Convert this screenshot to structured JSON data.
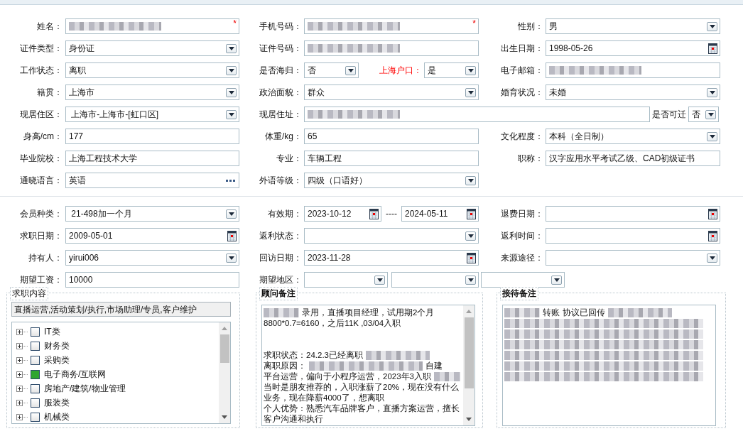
{
  "form_rows": [
    {
      "cells": [
        {
          "label": "姓名：",
          "controls": [
            {
              "kind": "text",
              "redacted": true,
              "required_mark": "*"
            }
          ]
        },
        {
          "label": "手机号码：",
          "controls": [
            {
              "kind": "text",
              "redacted": true,
              "required_mark": "*"
            }
          ]
        },
        {
          "label": "性别：",
          "controls": [
            {
              "kind": "select",
              "value": "男"
            }
          ]
        }
      ]
    },
    {
      "cells": [
        {
          "label": "证件类型：",
          "controls": [
            {
              "kind": "select",
              "value": "身份证"
            }
          ]
        },
        {
          "label": "证件号码：",
          "controls": [
            {
              "kind": "text",
              "redacted": true
            }
          ]
        },
        {
          "label": "出生日期：",
          "controls": [
            {
              "kind": "date",
              "value": "1998-05-26"
            }
          ]
        }
      ]
    },
    {
      "cells": [
        {
          "label": "工作状态：",
          "controls": [
            {
              "kind": "select",
              "value": "离职"
            }
          ]
        },
        {
          "label": "是否海归：",
          "controls": [
            {
              "kind": "select",
              "value": "否"
            },
            {
              "kind": "label",
              "text": "上海户口：",
              "highlighted": true
            },
            {
              "kind": "select",
              "value": "是"
            }
          ]
        },
        {
          "label": "电子邮箱：",
          "controls": [
            {
              "kind": "text",
              "redacted": true
            }
          ]
        }
      ]
    },
    {
      "cells": [
        {
          "label": "籍贯：",
          "controls": [
            {
              "kind": "select",
              "value": "上海市"
            }
          ]
        },
        {
          "label": "政治面貌：",
          "controls": [
            {
              "kind": "select",
              "value": "群众"
            }
          ]
        },
        {
          "label": "婚育状况：",
          "controls": [
            {
              "kind": "select",
              "value": "未婚"
            }
          ]
        }
      ]
    },
    {
      "cells": [
        {
          "label": "现居住区：",
          "controls": [
            {
              "kind": "select",
              "value": " 上海市-上海市-[虹口区]"
            }
          ]
        },
        {
          "label": "现居住址：",
          "controls": [
            {
              "kind": "text",
              "redacted": true
            },
            {
              "kind": "label",
              "text": "是否可迁"
            },
            {
              "kind": "select",
              "value": "否"
            }
          ]
        }
      ]
    },
    {
      "cells": [
        {
          "label": "身高/cm：",
          "controls": [
            {
              "kind": "text",
              "value": "177"
            }
          ]
        },
        {
          "label": "体重/kg：",
          "controls": [
            {
              "kind": "text",
              "value": "65"
            }
          ]
        },
        {
          "label": "文化程度：",
          "controls": [
            {
              "kind": "select",
              "value": "本科（全日制）"
            }
          ]
        }
      ]
    },
    {
      "cells": [
        {
          "label": "毕业院校：",
          "controls": [
            {
              "kind": "text",
              "value": "上海工程技术大学"
            }
          ]
        },
        {
          "label": "专业：",
          "controls": [
            {
              "kind": "text",
              "value": "车辆工程"
            }
          ]
        },
        {
          "label": "职称：",
          "controls": [
            {
              "kind": "text",
              "value": "汉字应用水平考试乙级、CAD初级证书"
            }
          ]
        }
      ]
    },
    {
      "cells": [
        {
          "label": "通晓语言：",
          "controls": [
            {
              "kind": "lookup",
              "value": "英语"
            }
          ]
        },
        {
          "label": "外语等级：",
          "controls": [
            {
              "kind": "select",
              "value": "四级（口语好）"
            }
          ]
        }
      ]
    }
  ],
  "member_rows": [
    {
      "cells": [
        {
          "label": "会员种类：",
          "controls": [
            {
              "kind": "select",
              "value": " 21-498加一个月"
            }
          ]
        },
        {
          "label": "有效期：",
          "controls": [
            {
              "kind": "date",
              "value": "2023-10-12"
            },
            {
              "kind": "label",
              "text": "----"
            },
            {
              "kind": "date",
              "value": "2024-05-11"
            }
          ]
        },
        {
          "label": "退费日期：",
          "controls": [
            {
              "kind": "date"
            }
          ]
        }
      ]
    },
    {
      "cells": [
        {
          "label": "求职日期：",
          "controls": [
            {
              "kind": "date",
              "value": "2009-05-01"
            }
          ]
        },
        {
          "label": "返利状态：",
          "controls": [
            {
              "kind": "select"
            }
          ]
        },
        {
          "label": "返利时间：",
          "controls": [
            {
              "kind": "date"
            }
          ]
        }
      ]
    },
    {
      "cells": [
        {
          "label": "持有人：",
          "controls": [
            {
              "kind": "select",
              "value": "yirui006"
            }
          ]
        },
        {
          "label": "回访日期：",
          "controls": [
            {
              "kind": "date",
              "value": "2023-11-28"
            }
          ]
        },
        {
          "label": "来源途径：",
          "controls": [
            {
              "kind": "select"
            }
          ]
        }
      ]
    },
    {
      "cells": [
        {
          "label": "期望工资：",
          "controls": [
            {
              "kind": "text",
              "value": "10000"
            }
          ]
        },
        {
          "label": "期望地区：",
          "controls": [
            {
              "kind": "select"
            },
            {
              "kind": "select"
            },
            {
              "kind": "select"
            }
          ]
        }
      ]
    }
  ],
  "panels": [
    {
      "kind": "tree",
      "title": "求职内容",
      "summary": "直播运营,活动策划/执行,市场助理/专员,客户维护",
      "items": [
        {
          "label": "IT类",
          "checked": false
        },
        {
          "label": "财务类",
          "checked": false
        },
        {
          "label": "采购类",
          "checked": false
        },
        {
          "label": "电子商务/互联网",
          "checked": true
        },
        {
          "label": "房地产/建筑/物业管理",
          "checked": false
        },
        {
          "label": "服装类",
          "checked": false
        },
        {
          "label": "机械类",
          "checked": false
        }
      ]
    },
    {
      "kind": "notes",
      "title": "顾问备注",
      "scrollbar": true,
      "lines": [
        {
          "segments": [
            {
              "kind": "redacted"
            },
            {
              "kind": "text",
              "text": "录用，直播项目经理，试用期2个月"
            }
          ]
        },
        {
          "segments": [
            {
              "kind": "text",
              "text": "8800*0.7=6160，之后11K ,03/04入职"
            }
          ],
          "gap_after": true
        },
        {
          "segments": [
            {
              "kind": "text",
              "text": "求职状态：24.2.3已经离职"
            },
            {
              "kind": "redacted"
            }
          ]
        },
        {
          "segments": [
            {
              "kind": "text",
              "text": "离职原因："
            },
            {
              "kind": "redacted"
            },
            {
              "kind": "text",
              "text": "自建"
            }
          ]
        },
        {
          "segments": [
            {
              "kind": "text",
              "text": "平台运营，偏向于小程序运营，2023年3入职"
            },
            {
              "kind": "redacted"
            }
          ]
        },
        {
          "segments": [
            {
              "kind": "text",
              "text": "当时是朋友推荐的，入职涨薪了20%，现在没有什么"
            }
          ]
        },
        {
          "segments": [
            {
              "kind": "text",
              "text": "业务，现在降薪4000了，想离职"
            }
          ]
        },
        {
          "segments": [
            {
              "kind": "text",
              "text": "个人优势：熟悉汽车品牌客户，直播方案运营，擅长"
            }
          ]
        },
        {
          "segments": [
            {
              "kind": "text",
              "text": "客户沟通和执行"
            }
          ]
        }
      ]
    },
    {
      "kind": "notes",
      "title": "接待备注",
      "scrollbar": false,
      "lines": [
        {
          "segments": [
            {
              "kind": "redacted"
            },
            {
              "kind": "text",
              "text": "转账"
            },
            {
              "kind": "text",
              "text": "协议已回传"
            },
            {
              "kind": "redacted"
            }
          ]
        },
        {
          "segments": [
            {
              "kind": "redacted"
            }
          ]
        },
        {
          "segments": [
            {
              "kind": "redacted"
            }
          ]
        },
        {
          "segments": [
            {
              "kind": "redacted"
            }
          ]
        },
        {
          "segments": [
            {
              "kind": "redacted"
            }
          ]
        },
        {
          "segments": [
            {
              "kind": "redacted"
            }
          ]
        },
        {
          "segments": [
            {
              "kind": "redacted"
            }
          ]
        }
      ]
    }
  ]
}
